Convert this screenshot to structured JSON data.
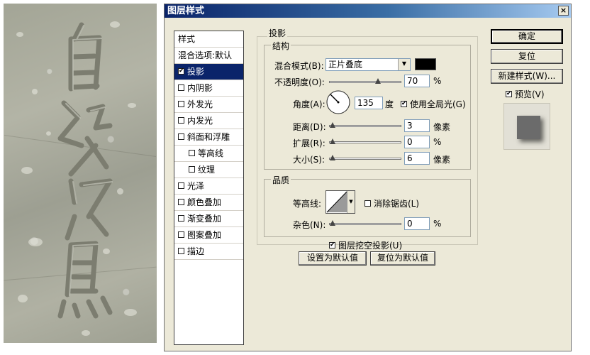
{
  "window": {
    "title": "图层样式",
    "close": "×"
  },
  "styles_list": {
    "header": "样式",
    "items": [
      {
        "label": "混合选项:默认",
        "checked": null,
        "indent": false,
        "selected": false
      },
      {
        "label": "投影",
        "checked": true,
        "indent": false,
        "selected": true
      },
      {
        "label": "内阴影",
        "checked": false,
        "indent": false,
        "selected": false
      },
      {
        "label": "外发光",
        "checked": false,
        "indent": false,
        "selected": false
      },
      {
        "label": "内发光",
        "checked": false,
        "indent": false,
        "selected": false
      },
      {
        "label": "斜面和浮雕",
        "checked": false,
        "indent": false,
        "selected": false
      },
      {
        "label": "等高线",
        "checked": false,
        "indent": true,
        "selected": false
      },
      {
        "label": "纹理",
        "checked": false,
        "indent": true,
        "selected": false
      },
      {
        "label": "光泽",
        "checked": false,
        "indent": false,
        "selected": false
      },
      {
        "label": "颜色叠加",
        "checked": false,
        "indent": false,
        "selected": false
      },
      {
        "label": "渐变叠加",
        "checked": false,
        "indent": false,
        "selected": false
      },
      {
        "label": "图案叠加",
        "checked": false,
        "indent": false,
        "selected": false
      },
      {
        "label": "描边",
        "checked": false,
        "indent": false,
        "selected": false
      }
    ]
  },
  "drop_shadow": {
    "group_title": "投影",
    "structure": {
      "title": "结构",
      "blend_mode_label": "混合模式(B):",
      "blend_mode_value": "正片叠底",
      "shadow_color": "#000000",
      "opacity_label": "不透明度(O):",
      "opacity_value": "70",
      "opacity_unit": "%",
      "opacity_level": 0.7,
      "angle_label": "角度(A):",
      "angle_value": "135",
      "angle_unit": "度",
      "global_light_label": "使用全局光(G)",
      "global_light_checked": true,
      "distance_label": "距离(D):",
      "distance_value": "3",
      "distance_unit": "像素",
      "distance_level": 0.0,
      "spread_label": "扩展(R):",
      "spread_value": "0",
      "spread_unit": "%",
      "spread_level": 0.0,
      "size_label": "大小(S):",
      "size_value": "6",
      "size_unit": "像素",
      "size_level": 0.0
    },
    "quality": {
      "title": "品质",
      "contour_label": "等高线:",
      "antialias_label": "消除锯齿(L)",
      "antialias_checked": false,
      "noise_label": "杂色(N):",
      "noise_value": "0",
      "noise_unit": "%",
      "noise_level": 0.0
    },
    "knockout_label": "图层挖空投影(U)",
    "knockout_checked": true,
    "set_default_button": "设置为默认值",
    "reset_default_button": "复位为默认值"
  },
  "buttons": {
    "ok": "确定",
    "reset": "复位",
    "new_style": "新建样式(W)...",
    "preview_label": "预览(V)",
    "preview_checked": true
  },
  "colors": {
    "accent": "#0a246a",
    "dialog_bg": "#ece9d8"
  }
}
